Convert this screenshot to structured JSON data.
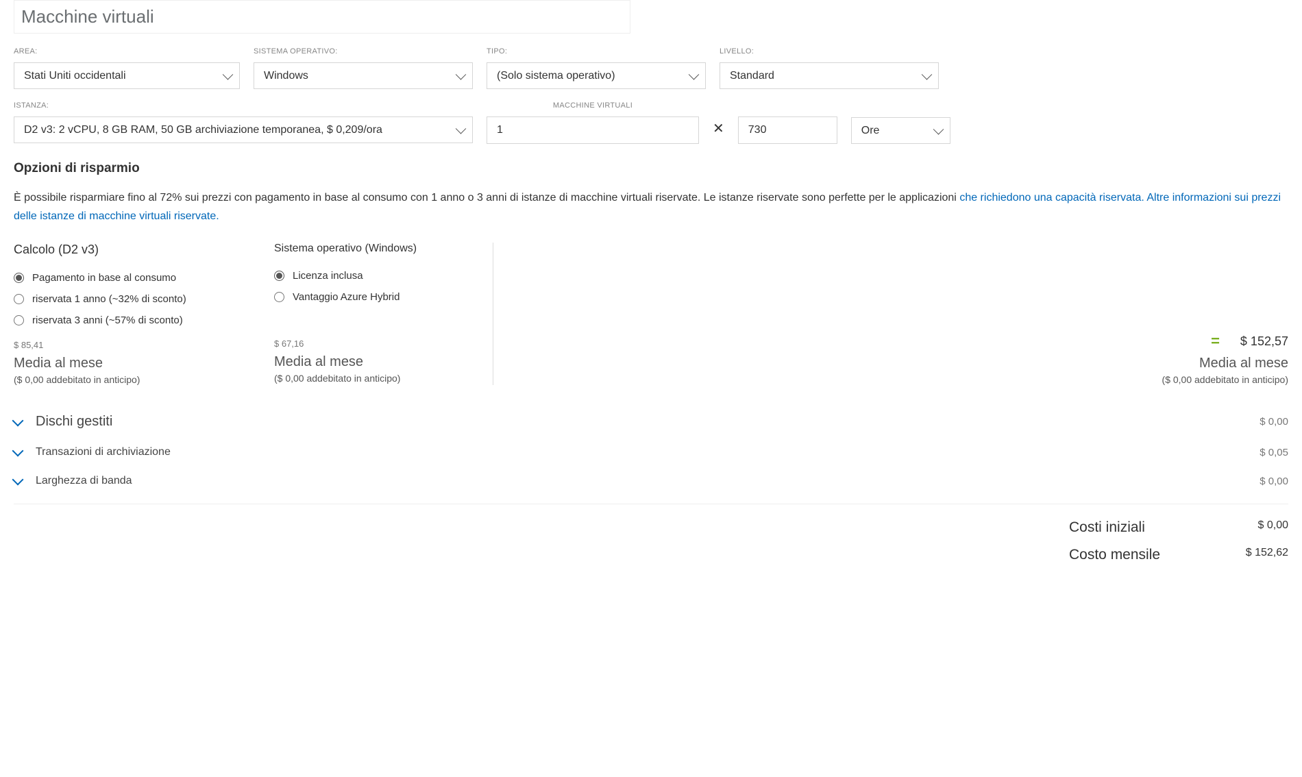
{
  "title": "Macchine virtuali",
  "fields": {
    "area": {
      "label": "AREA:",
      "value": "Stati Uniti occidentali"
    },
    "os": {
      "label": "SISTEMA OPERATIVO:",
      "value": "Windows"
    },
    "type": {
      "label": "TIPO:",
      "value": "(Solo sistema operativo)"
    },
    "tier": {
      "label": "LIVELLO:",
      "value": "Standard"
    },
    "instance": {
      "label": "ISTANZA:",
      "value": "D2 v3: 2 vCPU, 8 GB RAM, 50 GB archiviazione temporanea, $ 0,209/ora"
    },
    "vm_count": {
      "label": "MACCHINE VIRTUALI",
      "value": "1"
    },
    "hours": {
      "value": "730"
    },
    "unit": {
      "value": "Ore"
    }
  },
  "savings": {
    "heading": "Opzioni di risparmio",
    "text": "È possibile risparmiare fino al 72% sui prezzi con pagamento in base al consumo con 1 anno o 3 anni di istanze di macchine virtuali riservate. Le istanze riservate sono perfette per le applicazioni ",
    "link1": "che richiedono una capacità riservata.",
    "link2": " Altre informazioni sui prezzi delle istanze di macchine virtuali riservate."
  },
  "compute": {
    "title": "Calcolo (D2 v3)",
    "opts": [
      "Pagamento in base al consumo",
      "riservata 1 anno (~32% di sconto)",
      "riservata 3 anni (~57% di sconto)"
    ],
    "price": "$ 85,41",
    "label": "Media al mese",
    "sub": "($ 0,00 addebitato in anticipo)"
  },
  "ossec": {
    "title": "Sistema operativo (Windows)",
    "opts": [
      "Licenza inclusa",
      "Vantaggio Azure Hybrid"
    ],
    "price": "$ 67,16",
    "label": "Media al mese",
    "sub": "($ 0,00 addebitato in anticipo)"
  },
  "total": {
    "eq": "=",
    "price": "$ 152,57",
    "label": "Media al mese",
    "sub": "($ 0,00 addebitato in anticipo)"
  },
  "acc": [
    {
      "title": "Dischi gestiti",
      "price": "$ 0,00",
      "big": true
    },
    {
      "title": "Transazioni di archiviazione",
      "price": "$ 0,05",
      "big": false
    },
    {
      "title": "Larghezza di banda",
      "price": "$ 0,00",
      "big": false
    }
  ],
  "summary": {
    "upfront_l": "Costi iniziali",
    "upfront_v": "$ 0,00",
    "monthly_l": "Costo mensile",
    "monthly_v": "$ 152,62"
  }
}
